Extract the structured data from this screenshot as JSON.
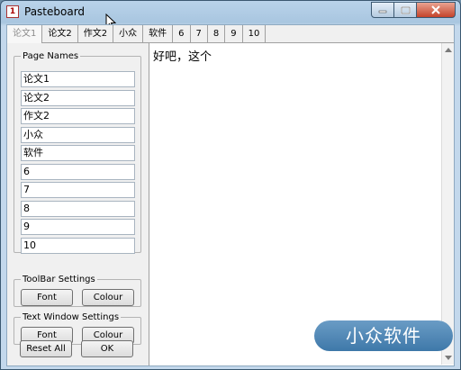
{
  "window": {
    "title": "Pasteboard",
    "app_icon_text": "1"
  },
  "tabs": [
    "论文1",
    "论文2",
    "作文2",
    "小众",
    "软件",
    "6",
    "7",
    "8",
    "9",
    "10"
  ],
  "active_tab_index": 0,
  "page_names": {
    "legend": "Page Names",
    "items": [
      "论文1",
      "论文2",
      "作文2",
      "小众",
      "软件",
      "6",
      "7",
      "8",
      "9",
      "10"
    ]
  },
  "toolbar_settings": {
    "legend": "ToolBar Settings",
    "font_label": "Font",
    "colour_label": "Colour"
  },
  "text_window_settings": {
    "legend": "Text Window Settings",
    "font_label": "Font",
    "colour_label": "Colour"
  },
  "footer": {
    "reset_label": "Reset All",
    "ok_label": "OK"
  },
  "text_window": {
    "content": "好吧，这个"
  },
  "watermark": {
    "text": "小众软件"
  },
  "colors": {
    "title_bar": "#a9c6e0",
    "close_button": "#c4432a",
    "watermark": "#3e78a9"
  }
}
